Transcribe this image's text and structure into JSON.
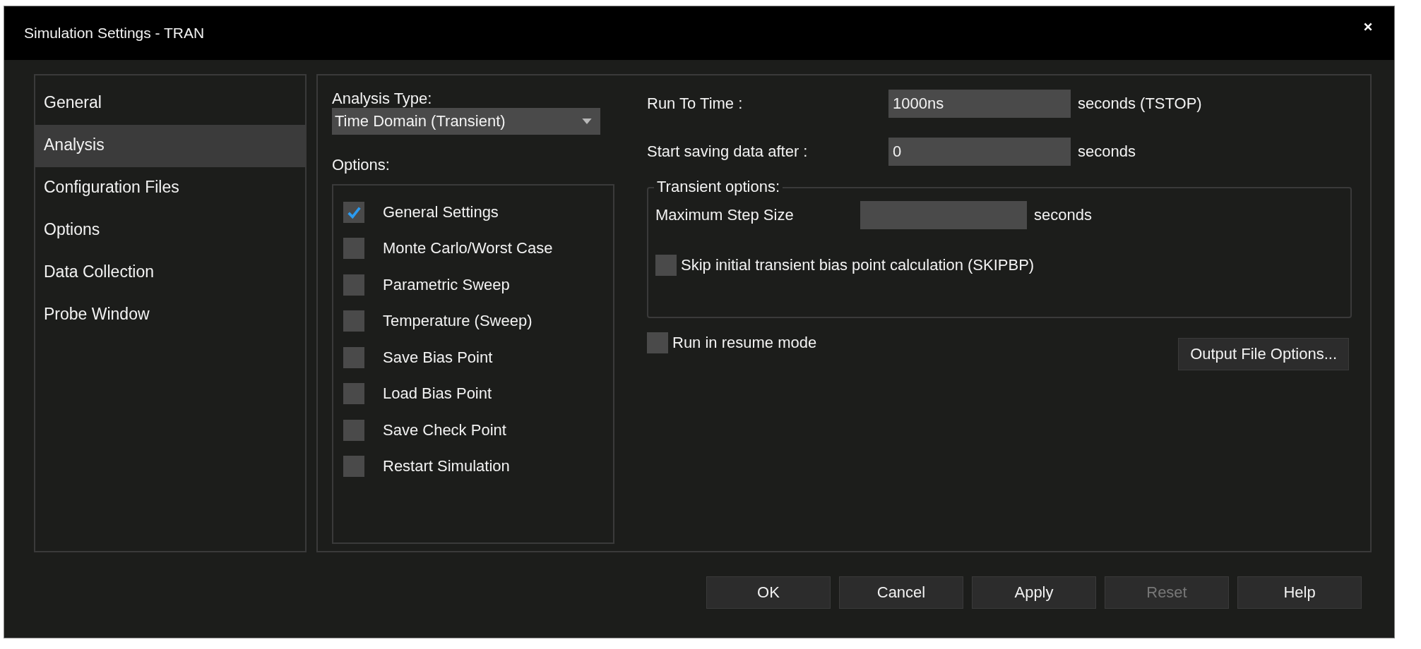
{
  "window": {
    "title": "Simulation Settings - TRAN"
  },
  "sidebar": {
    "items": [
      {
        "label": "General",
        "selected": false
      },
      {
        "label": "Analysis",
        "selected": true
      },
      {
        "label": "Configuration Files",
        "selected": false
      },
      {
        "label": "Options",
        "selected": false
      },
      {
        "label": "Data Collection",
        "selected": false
      },
      {
        "label": "Probe Window",
        "selected": false
      }
    ]
  },
  "analysis_type": {
    "label": "Analysis Type:",
    "value": "Time Domain (Transient)"
  },
  "options": {
    "label": "Options:",
    "items": [
      {
        "label": "General Settings",
        "checked": true
      },
      {
        "label": "Monte Carlo/Worst Case",
        "checked": false
      },
      {
        "label": "Parametric Sweep",
        "checked": false
      },
      {
        "label": "Temperature (Sweep)",
        "checked": false
      },
      {
        "label": "Save Bias Point",
        "checked": false
      },
      {
        "label": "Load Bias Point",
        "checked": false
      },
      {
        "label": "Save Check Point",
        "checked": false
      },
      {
        "label": "Restart Simulation",
        "checked": false
      }
    ]
  },
  "fields": [
    {
      "label": "Run To Time :",
      "value": "1000ns",
      "unit": "seconds (TSTOP)"
    },
    {
      "label": "Start saving data after :",
      "value": "0",
      "unit": "seconds"
    }
  ],
  "transient_options": {
    "legend": "Transient options:",
    "max_step": {
      "label": "Maximum Step Size",
      "unit": "seconds"
    },
    "skip_bias": {
      "label": "Skip initial transient bias point calculation (SKIPBP)",
      "checked": false
    }
  },
  "resume_mode": {
    "label": "Run in resume mode",
    "checked": false
  },
  "output_file_button": "Output File Options...",
  "buttons": [
    {
      "label": "OK",
      "disabled": false
    },
    {
      "label": "Cancel",
      "disabled": false
    },
    {
      "label": "Apply",
      "disabled": false
    },
    {
      "label": "Reset",
      "disabled": true
    },
    {
      "label": "Help",
      "disabled": false
    }
  ]
}
